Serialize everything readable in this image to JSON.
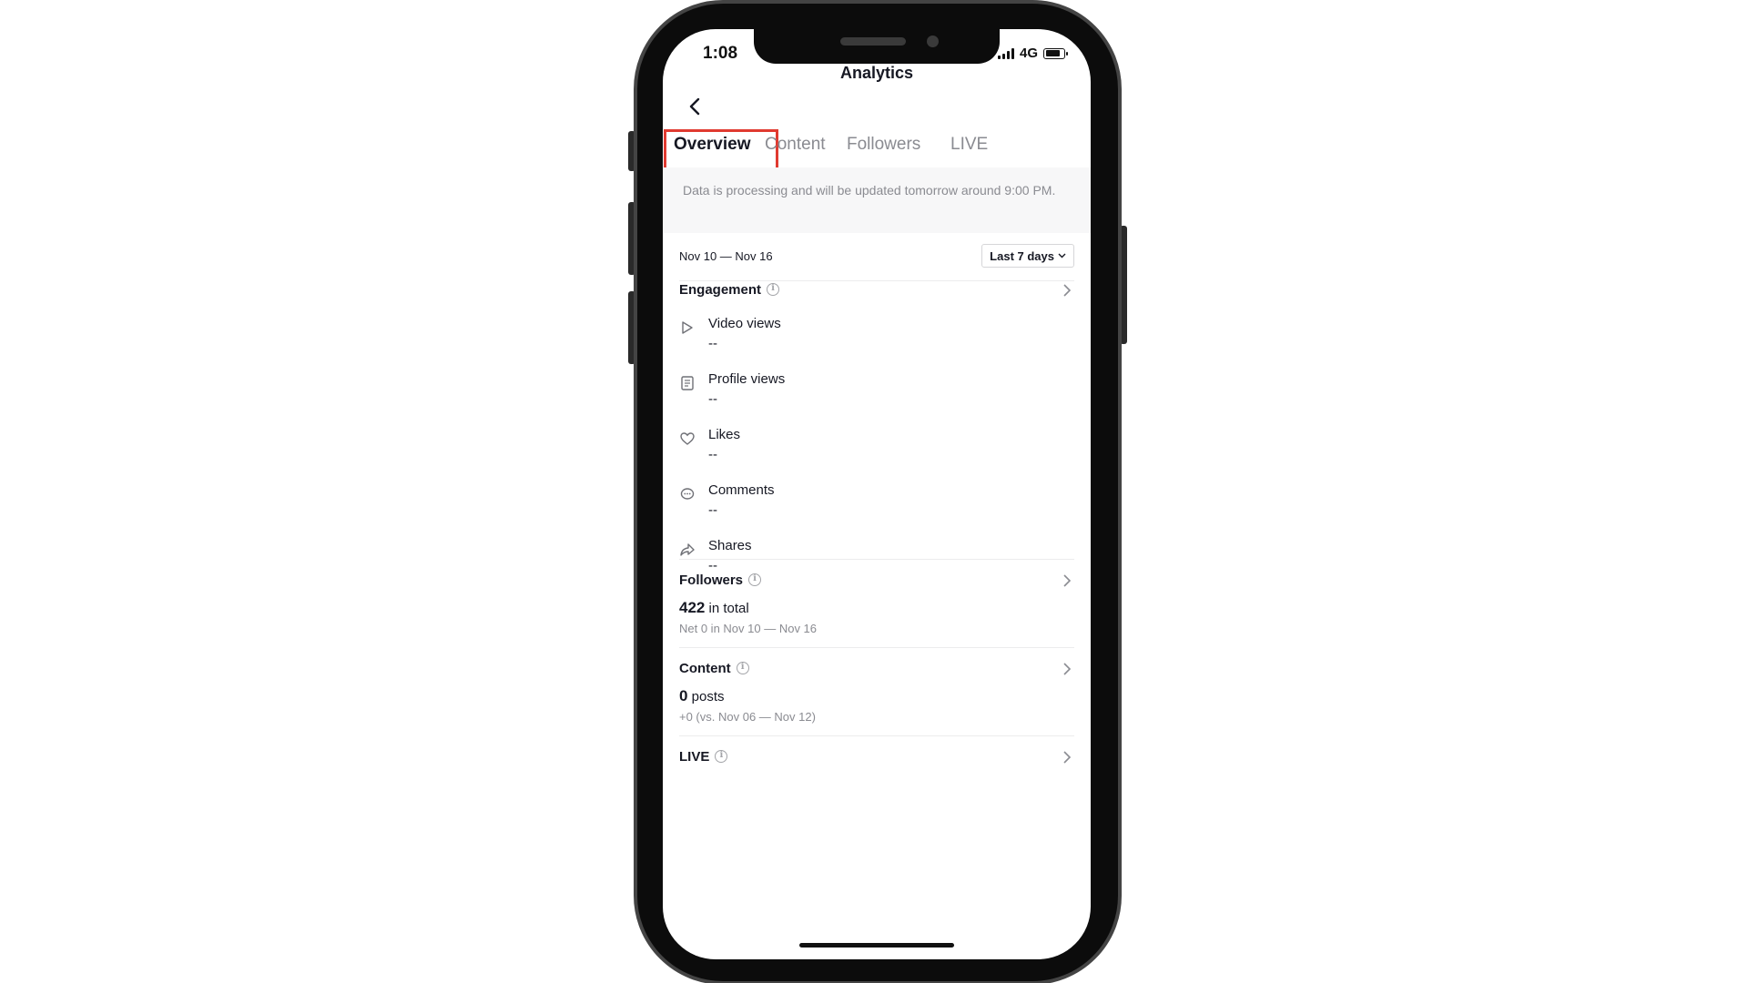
{
  "status_bar": {
    "time": "1:08",
    "network": "4G"
  },
  "header": {
    "title": "Analytics"
  },
  "tabs": [
    {
      "label": "Overview"
    },
    {
      "label": "Content"
    },
    {
      "label": "Followers"
    },
    {
      "label": "LIVE"
    }
  ],
  "banner": {
    "text": "Data is processing and will be updated tomorrow around 9:00 PM."
  },
  "date_row": {
    "range": "Nov 10 — Nov 16",
    "select_label": "Last 7 days"
  },
  "engagement": {
    "title": "Engagement",
    "metrics": [
      {
        "icon": "play-icon",
        "label": "Video views",
        "value": "--"
      },
      {
        "icon": "profile-card-icon",
        "label": "Profile views",
        "value": "--"
      },
      {
        "icon": "heart-icon",
        "label": "Likes",
        "value": "--"
      },
      {
        "icon": "comment-icon",
        "label": "Comments",
        "value": "--"
      },
      {
        "icon": "share-icon",
        "label": "Shares",
        "value": "--"
      }
    ]
  },
  "followers": {
    "title": "Followers",
    "count": "422",
    "count_suffix": " in total",
    "sub": "Net 0 in Nov 10 — Nov 16"
  },
  "content": {
    "title": "Content",
    "count": "0",
    "count_suffix": " posts",
    "sub": "+0 (vs. Nov 06 — Nov 12)"
  },
  "live": {
    "title": "LIVE"
  },
  "colors": {
    "highlight": "#e03a30",
    "text": "#161823",
    "muted": "#8a8b91"
  }
}
